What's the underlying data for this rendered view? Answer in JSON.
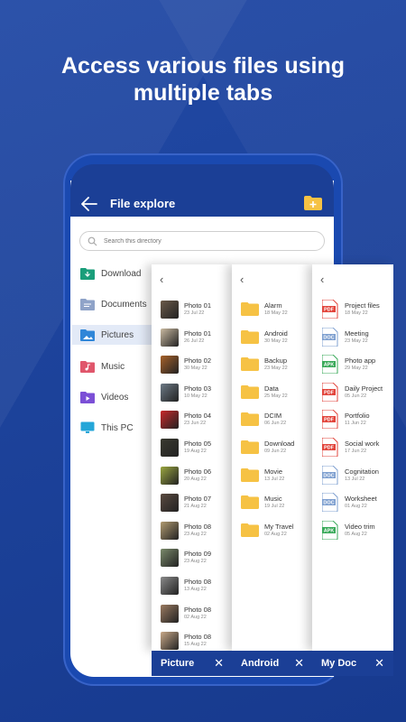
{
  "headline": "Access various files using multiple tabs",
  "headline_lines": [
    "Access various files using",
    "multiple tabs"
  ],
  "app": {
    "title": "File explore",
    "search_placeholder": "Search this directory"
  },
  "sidebar": {
    "items": [
      {
        "label": "Download",
        "icon": "download-folder-icon",
        "color": "#1a9e7a"
      },
      {
        "label": "Documents",
        "icon": "documents-folder-icon",
        "color": "#8fa3c8"
      },
      {
        "label": "Pictures",
        "icon": "pictures-folder-icon",
        "color": "#2f86d8",
        "active": true
      },
      {
        "label": "Music",
        "icon": "music-folder-icon",
        "color": "#e0566b"
      },
      {
        "label": "Videos",
        "icon": "videos-folder-icon",
        "color": "#7b4fd6"
      },
      {
        "label": "This PC",
        "icon": "monitor-icon",
        "color": "#24a6d8"
      }
    ]
  },
  "panels": [
    {
      "tab_label": "Picture",
      "kind": "photos",
      "items": [
        {
          "name": "Photo 01",
          "date": "23 Jul 22",
          "color": "#6b5a4a"
        },
        {
          "name": "Photo 01",
          "date": "26 Jul 22",
          "color": "#c9b9a0"
        },
        {
          "name": "Photo 02",
          "date": "30 May 22",
          "color": "#a6612a"
        },
        {
          "name": "Photo 03",
          "date": "10 May 22",
          "color": "#6d7a86"
        },
        {
          "name": "Photo 04",
          "date": "23 Jun 22",
          "color": "#c8282a"
        },
        {
          "name": "Photo 05",
          "date": "19 Aug 22",
          "color": "#3a3a30"
        },
        {
          "name": "Photo 06",
          "date": "20 Aug 22",
          "color": "#9aa640"
        },
        {
          "name": "Photo 07",
          "date": "21 Aug 22",
          "color": "#5a4a40"
        },
        {
          "name": "Photo 08",
          "date": "23 Aug 22",
          "color": "#b09a70"
        },
        {
          "name": "Photo 09",
          "date": "23 Aug 22",
          "color": "#7a8a6a"
        },
        {
          "name": "Photo 08",
          "date": "13 Aug 22",
          "color": "#8a8a8a"
        },
        {
          "name": "Photo 08",
          "date": "02 Aug 22",
          "color": "#9a7a60"
        },
        {
          "name": "Photo 08",
          "date": "15 Aug 22",
          "color": "#c8a888"
        }
      ]
    },
    {
      "tab_label": "Android",
      "kind": "folders",
      "items": [
        {
          "name": "Alarm",
          "date": "18 May 22"
        },
        {
          "name": "Android",
          "date": "30 May 22"
        },
        {
          "name": "Backup",
          "date": "23 May 22"
        },
        {
          "name": "Data",
          "date": "25 May 22"
        },
        {
          "name": "DCIM",
          "date": "06 Jun 22"
        },
        {
          "name": "Download",
          "date": "09 Jun 22"
        },
        {
          "name": "Movie",
          "date": "13 Jul 22"
        },
        {
          "name": "Music",
          "date": "19 Jul 22"
        },
        {
          "name": "My Travel",
          "date": "02 Aug 22"
        }
      ]
    },
    {
      "tab_label": "My Doc",
      "kind": "docs",
      "items": [
        {
          "name": "Project files",
          "date": "18 May 22",
          "type": "PDF",
          "color": "#e2453c"
        },
        {
          "name": "Meeting",
          "date": "23 May 22",
          "type": "DOC",
          "color": "#7fa0d0"
        },
        {
          "name": "Photo app",
          "date": "29 May 22",
          "type": "APK",
          "color": "#3aaa5a"
        },
        {
          "name": "Daily Project",
          "date": "05 Jun 22",
          "type": "PDF",
          "color": "#e2453c"
        },
        {
          "name": "Portfolio",
          "date": "11 Jun 22",
          "type": "PDF",
          "color": "#e2453c"
        },
        {
          "name": "Social work",
          "date": "17 Jun 22",
          "type": "PDF",
          "color": "#e2453c"
        },
        {
          "name": "Cognitation",
          "date": "13 Jul 22",
          "type": "DOC",
          "color": "#7fa0d0"
        },
        {
          "name": "Worksheet",
          "date": "01 Aug 22",
          "type": "DOC",
          "color": "#7fa0d0"
        },
        {
          "name": "Video trim",
          "date": "05 Aug 22",
          "type": "APK",
          "color": "#3aaa5a"
        }
      ]
    }
  ],
  "colors": {
    "background": "#1b3f96",
    "folder": "#f6c244",
    "accent": "#1b3f96"
  }
}
